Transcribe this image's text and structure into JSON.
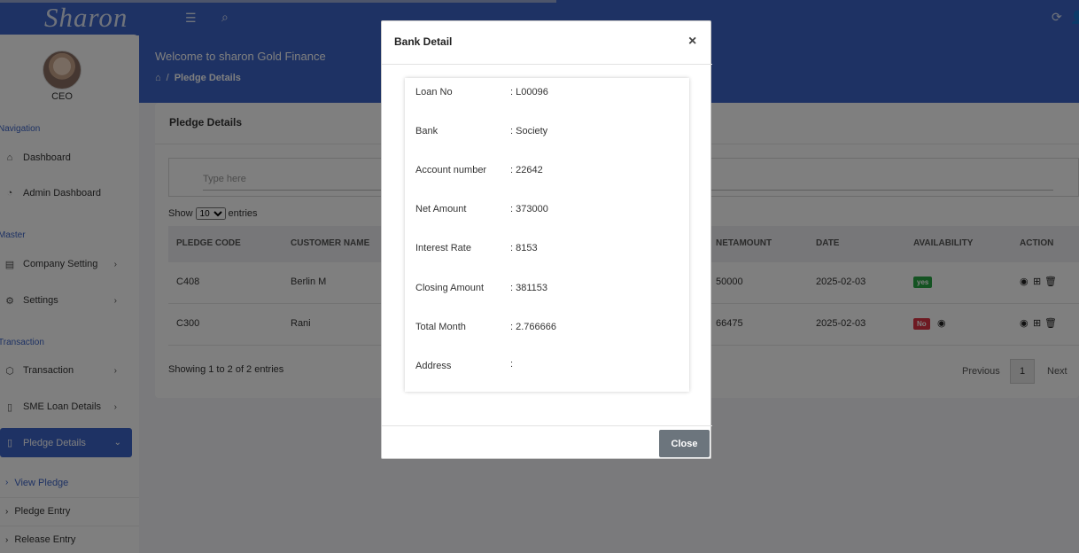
{
  "brand": "Sharon",
  "header": {
    "welcome": "Welcome to sharon Gold Finance",
    "breadcrumb": "Pledge Details"
  },
  "sidebar": {
    "role": "CEO",
    "sections": {
      "navigation": "Navigation",
      "master": "Master",
      "transaction": "Transaction"
    },
    "items": {
      "dashboard": "Dashboard",
      "admin_dashboard": "Admin Dashboard",
      "company_setting": "Company Setting",
      "settings": "Settings",
      "transaction": "Transaction",
      "sme_loan": "SME Loan Details",
      "pledge_details": "Pledge Details",
      "view_pledge": "View Pledge",
      "pledge_entry": "Pledge Entry",
      "release_entry": "Release Entry"
    }
  },
  "main": {
    "card_title": "Pledge Details",
    "search_placeholder": "Type here",
    "show_label": "Show",
    "show_value": "10",
    "entries_label": "entries",
    "columns": [
      "PLEDGE CODE",
      "CUSTOMER NAME",
      "NETAMOUNT",
      "DATE",
      "AVAILABILITY",
      "ACTION"
    ],
    "rows": [
      {
        "code": "C408",
        "customer": "Berlin M",
        "netamount": "50000",
        "date": "2025-02-03",
        "availability": "yes"
      },
      {
        "code": "C300",
        "customer": "Rani",
        "netamount": "66475",
        "date": "2025-02-03",
        "availability": "No"
      }
    ],
    "footer_info": "Showing 1 to 2 of 2 entries",
    "pagination": {
      "previous": "Previous",
      "page": "1",
      "next": "Next"
    }
  },
  "modal": {
    "title": "Bank Detail",
    "close_x": "×",
    "fields": [
      {
        "label": "Loan No",
        "value": ": L00096"
      },
      {
        "label": "Bank",
        "value": ": Society"
      },
      {
        "label": "Account number",
        "value": ": 22642"
      },
      {
        "label": "Net Amount",
        "value": ": 373000"
      },
      {
        "label": "Interest Rate",
        "value": ": 8153"
      },
      {
        "label": "Closing Amount",
        "value": ": 381153"
      },
      {
        "label": "Total Month",
        "value": ": 2.766666"
      },
      {
        "label": "Address",
        "value": ":"
      }
    ],
    "close_button": "Close"
  },
  "colors": {
    "primary": "#3c64c8",
    "success": "#28a745",
    "danger": "#dc3545",
    "secondary": "#6c757d"
  },
  "icons": [
    "menu-icon",
    "search-icon",
    "refresh-icon",
    "user-icon",
    "home-icon",
    "dashboard-icon",
    "pie-icon",
    "company-icon",
    "gear-icon",
    "cube-icon",
    "document-icon",
    "eye-icon",
    "plus-icon",
    "trash-icon",
    "close-icon"
  ]
}
